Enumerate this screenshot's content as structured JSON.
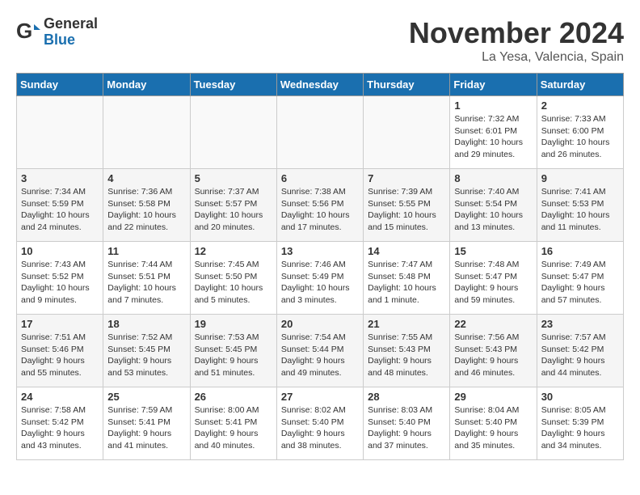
{
  "header": {
    "logo_general": "General",
    "logo_blue": "Blue",
    "month_title": "November 2024",
    "location": "La Yesa, Valencia, Spain"
  },
  "days_of_week": [
    "Sunday",
    "Monday",
    "Tuesday",
    "Wednesday",
    "Thursday",
    "Friday",
    "Saturday"
  ],
  "weeks": [
    [
      {
        "day": "",
        "info": ""
      },
      {
        "day": "",
        "info": ""
      },
      {
        "day": "",
        "info": ""
      },
      {
        "day": "",
        "info": ""
      },
      {
        "day": "",
        "info": ""
      },
      {
        "day": "1",
        "info": "Sunrise: 7:32 AM\nSunset: 6:01 PM\nDaylight: 10 hours and 29 minutes."
      },
      {
        "day": "2",
        "info": "Sunrise: 7:33 AM\nSunset: 6:00 PM\nDaylight: 10 hours and 26 minutes."
      }
    ],
    [
      {
        "day": "3",
        "info": "Sunrise: 7:34 AM\nSunset: 5:59 PM\nDaylight: 10 hours and 24 minutes."
      },
      {
        "day": "4",
        "info": "Sunrise: 7:36 AM\nSunset: 5:58 PM\nDaylight: 10 hours and 22 minutes."
      },
      {
        "day": "5",
        "info": "Sunrise: 7:37 AM\nSunset: 5:57 PM\nDaylight: 10 hours and 20 minutes."
      },
      {
        "day": "6",
        "info": "Sunrise: 7:38 AM\nSunset: 5:56 PM\nDaylight: 10 hours and 17 minutes."
      },
      {
        "day": "7",
        "info": "Sunrise: 7:39 AM\nSunset: 5:55 PM\nDaylight: 10 hours and 15 minutes."
      },
      {
        "day": "8",
        "info": "Sunrise: 7:40 AM\nSunset: 5:54 PM\nDaylight: 10 hours and 13 minutes."
      },
      {
        "day": "9",
        "info": "Sunrise: 7:41 AM\nSunset: 5:53 PM\nDaylight: 10 hours and 11 minutes."
      }
    ],
    [
      {
        "day": "10",
        "info": "Sunrise: 7:43 AM\nSunset: 5:52 PM\nDaylight: 10 hours and 9 minutes."
      },
      {
        "day": "11",
        "info": "Sunrise: 7:44 AM\nSunset: 5:51 PM\nDaylight: 10 hours and 7 minutes."
      },
      {
        "day": "12",
        "info": "Sunrise: 7:45 AM\nSunset: 5:50 PM\nDaylight: 10 hours and 5 minutes."
      },
      {
        "day": "13",
        "info": "Sunrise: 7:46 AM\nSunset: 5:49 PM\nDaylight: 10 hours and 3 minutes."
      },
      {
        "day": "14",
        "info": "Sunrise: 7:47 AM\nSunset: 5:48 PM\nDaylight: 10 hours and 1 minute."
      },
      {
        "day": "15",
        "info": "Sunrise: 7:48 AM\nSunset: 5:47 PM\nDaylight: 9 hours and 59 minutes."
      },
      {
        "day": "16",
        "info": "Sunrise: 7:49 AM\nSunset: 5:47 PM\nDaylight: 9 hours and 57 minutes."
      }
    ],
    [
      {
        "day": "17",
        "info": "Sunrise: 7:51 AM\nSunset: 5:46 PM\nDaylight: 9 hours and 55 minutes."
      },
      {
        "day": "18",
        "info": "Sunrise: 7:52 AM\nSunset: 5:45 PM\nDaylight: 9 hours and 53 minutes."
      },
      {
        "day": "19",
        "info": "Sunrise: 7:53 AM\nSunset: 5:45 PM\nDaylight: 9 hours and 51 minutes."
      },
      {
        "day": "20",
        "info": "Sunrise: 7:54 AM\nSunset: 5:44 PM\nDaylight: 9 hours and 49 minutes."
      },
      {
        "day": "21",
        "info": "Sunrise: 7:55 AM\nSunset: 5:43 PM\nDaylight: 9 hours and 48 minutes."
      },
      {
        "day": "22",
        "info": "Sunrise: 7:56 AM\nSunset: 5:43 PM\nDaylight: 9 hours and 46 minutes."
      },
      {
        "day": "23",
        "info": "Sunrise: 7:57 AM\nSunset: 5:42 PM\nDaylight: 9 hours and 44 minutes."
      }
    ],
    [
      {
        "day": "24",
        "info": "Sunrise: 7:58 AM\nSunset: 5:42 PM\nDaylight: 9 hours and 43 minutes."
      },
      {
        "day": "25",
        "info": "Sunrise: 7:59 AM\nSunset: 5:41 PM\nDaylight: 9 hours and 41 minutes."
      },
      {
        "day": "26",
        "info": "Sunrise: 8:00 AM\nSunset: 5:41 PM\nDaylight: 9 hours and 40 minutes."
      },
      {
        "day": "27",
        "info": "Sunrise: 8:02 AM\nSunset: 5:40 PM\nDaylight: 9 hours and 38 minutes."
      },
      {
        "day": "28",
        "info": "Sunrise: 8:03 AM\nSunset: 5:40 PM\nDaylight: 9 hours and 37 minutes."
      },
      {
        "day": "29",
        "info": "Sunrise: 8:04 AM\nSunset: 5:40 PM\nDaylight: 9 hours and 35 minutes."
      },
      {
        "day": "30",
        "info": "Sunrise: 8:05 AM\nSunset: 5:39 PM\nDaylight: 9 hours and 34 minutes."
      }
    ]
  ]
}
